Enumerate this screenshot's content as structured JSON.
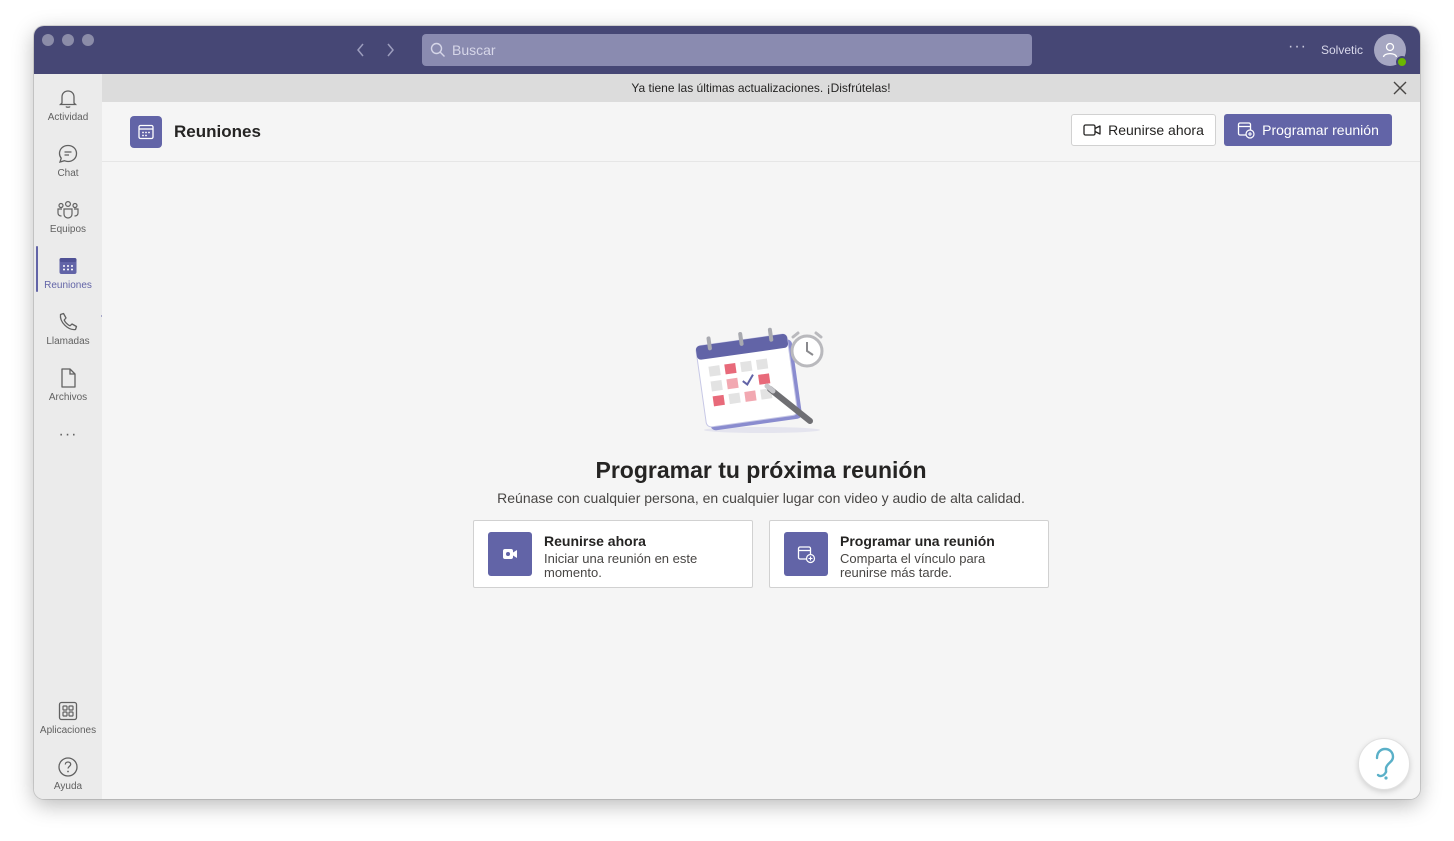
{
  "titlebar": {
    "search_placeholder": "Buscar",
    "user_name": "Solvetic",
    "more_label": "···"
  },
  "rail": {
    "items": [
      {
        "label": "Actividad",
        "icon": "bell-icon"
      },
      {
        "label": "Chat",
        "icon": "chat-icon"
      },
      {
        "label": "Equipos",
        "icon": "teams-icon"
      },
      {
        "label": "Reuniones",
        "icon": "calendar-icon",
        "active": true
      },
      {
        "label": "Llamadas",
        "icon": "phone-icon"
      },
      {
        "label": "Archivos",
        "icon": "file-icon"
      }
    ],
    "more_label": "···",
    "bottom_items": [
      {
        "label": "Aplicaciones",
        "icon": "apps-icon"
      },
      {
        "label": "Ayuda",
        "icon": "help-icon"
      }
    ]
  },
  "banner": {
    "text": "Ya tiene las últimas actualizaciones. ¡Disfrútelas!"
  },
  "header": {
    "title": "Reuniones",
    "meet_now_label": "Reunirse ahora",
    "schedule_label": "Programar reunión"
  },
  "empty_state": {
    "title": "Programar tu próxima reunión",
    "subtitle": "Reúnase con cualquier persona, en cualquier lugar con video y audio de alta calidad.",
    "cards": [
      {
        "title": "Reunirse ahora",
        "desc": "Iniciar una reunión en este momento."
      },
      {
        "title": "Programar una reunión",
        "desc": "Comparta el vínculo para reunirse más tarde."
      }
    ]
  },
  "colors": {
    "brand": "#6264a7",
    "titlebar": "#464775",
    "rail": "#ebebeb",
    "background": "#f5f5f5"
  }
}
